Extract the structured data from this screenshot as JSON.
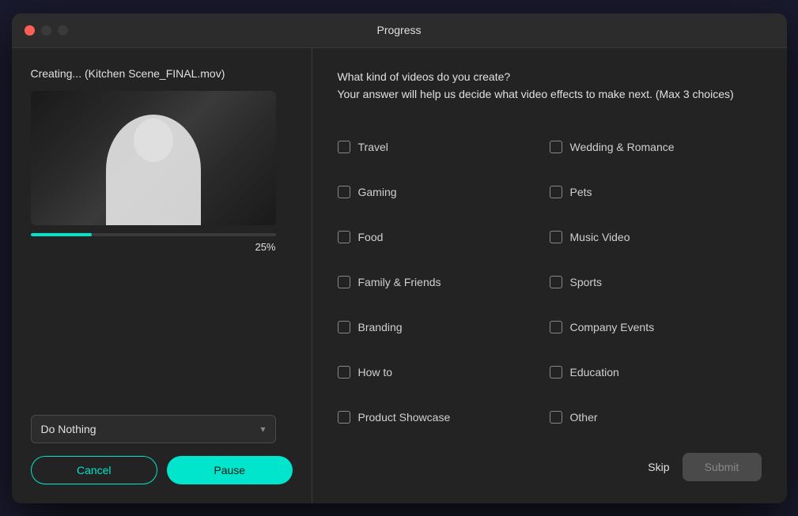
{
  "window": {
    "title": "Progress",
    "traffic_lights": {
      "close": "close",
      "minimize": "minimize",
      "maximize": "maximize"
    }
  },
  "left_panel": {
    "creating_label": "Creating... (Kitchen Scene_FINAL.mov)",
    "progress_percent": 25,
    "progress_percent_label": "25%",
    "dropdown": {
      "value": "Do Nothing",
      "chevron": "▾"
    },
    "buttons": {
      "cancel": "Cancel",
      "pause": "Pause"
    }
  },
  "right_panel": {
    "question_line1": "What kind of videos do you create?",
    "question_line2": "Your answer will help us decide what video effects to make next.  (Max 3 choices)",
    "choices_col1": [
      {
        "id": "travel",
        "label": "Travel",
        "checked": false
      },
      {
        "id": "gaming",
        "label": "Gaming",
        "checked": false
      },
      {
        "id": "food",
        "label": "Food",
        "checked": false
      },
      {
        "id": "family",
        "label": "Family & Friends",
        "checked": false
      },
      {
        "id": "branding",
        "label": "Branding",
        "checked": false
      },
      {
        "id": "howto",
        "label": "How to",
        "checked": false
      },
      {
        "id": "product",
        "label": "Product Showcase",
        "checked": false
      }
    ],
    "choices_col2": [
      {
        "id": "wedding",
        "label": "Wedding & Romance",
        "checked": false
      },
      {
        "id": "pets",
        "label": "Pets",
        "checked": false
      },
      {
        "id": "music",
        "label": "Music Video",
        "checked": false
      },
      {
        "id": "sports",
        "label": "Sports",
        "checked": false
      },
      {
        "id": "company",
        "label": "Company Events",
        "checked": false
      },
      {
        "id": "education",
        "label": "Education",
        "checked": false
      },
      {
        "id": "other",
        "label": "Other",
        "checked": false
      }
    ],
    "buttons": {
      "skip": "Skip",
      "submit": "Submit"
    }
  }
}
